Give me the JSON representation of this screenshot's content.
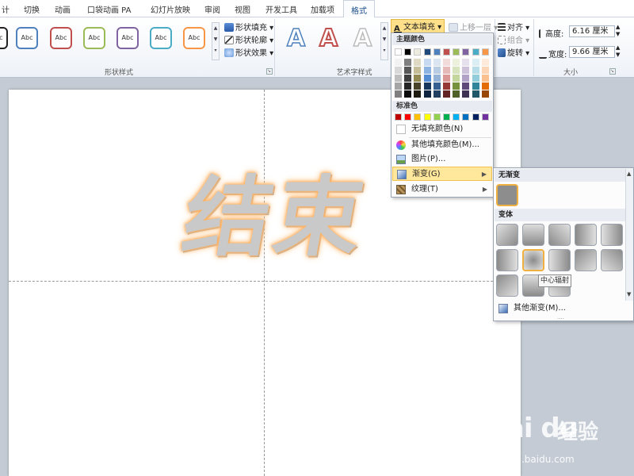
{
  "tabs": {
    "items": [
      "计",
      "切换",
      "动画",
      "口袋动画 PA",
      "幻灯片放映",
      "审阅",
      "视图",
      "开发工具",
      "加载项"
    ],
    "active": "格式"
  },
  "ribbon": {
    "shape_styles": {
      "gallery": [
        "Abc",
        "Abc",
        "Abc",
        "Abc",
        "Abc",
        "Abc",
        "Abc"
      ],
      "fill": "形状填充",
      "outline": "形状轮廓",
      "effects": "形状效果",
      "label": "形状样式"
    },
    "wordart_styles": {
      "letters": [
        "A",
        "A",
        "A"
      ],
      "text_fill": "文本填充",
      "label": "艺术字样式"
    },
    "arrange": {
      "bring_forward": "上移一层",
      "align": "对齐",
      "group": "组合",
      "rotate": "旋转"
    },
    "size": {
      "height_label": "高度:",
      "height_value": "6.16 厘米",
      "width_label": "宽度:",
      "width_value": "9.66 厘米",
      "label": "大小"
    }
  },
  "slide": {
    "wordart_text": "结束"
  },
  "fill_menu": {
    "theme_colors_header": "主题颜色",
    "standard_colors_header": "标准色",
    "theme_colors": {
      "top": [
        "#ffffff",
        "#000000",
        "#eeece1",
        "#1f497d",
        "#4f81bd",
        "#c0504d",
        "#9bbb59",
        "#8064a2",
        "#4bacc6",
        "#f79646"
      ],
      "tints": [
        [
          "#f2f2f2",
          "#7f7f7f",
          "#ddd9c3",
          "#c6d9f0",
          "#dbe5f1",
          "#f2dcdb",
          "#ebf1dd",
          "#e5e0ec",
          "#dbeef3",
          "#fdeada"
        ],
        [
          "#d8d8d8",
          "#595959",
          "#c4bd97",
          "#8db3e2",
          "#b8cce4",
          "#e5b9b7",
          "#d7e3bc",
          "#ccc1d9",
          "#b7dde8",
          "#fbd5b5"
        ],
        [
          "#bfbfbf",
          "#3f3f3f",
          "#938953",
          "#548dd4",
          "#95b3d7",
          "#d99694",
          "#c3d69b",
          "#b2a2c7",
          "#92cddc",
          "#fac08f"
        ],
        [
          "#a5a5a5",
          "#262626",
          "#494429",
          "#17365d",
          "#366092",
          "#953734",
          "#76923c",
          "#5f497a",
          "#31859b",
          "#e36c09"
        ],
        [
          "#7f7f7f",
          "#0c0c0c",
          "#1d1b10",
          "#0f243e",
          "#244061",
          "#632423",
          "#4f6128",
          "#3f3151",
          "#205867",
          "#974806"
        ]
      ]
    },
    "standard_colors": [
      "#c00000",
      "#ff0000",
      "#ffc000",
      "#ffff00",
      "#92d050",
      "#00b050",
      "#00b0f0",
      "#0070c0",
      "#002060",
      "#7030a0"
    ],
    "no_fill": "无填充颜色(N)",
    "more_colors": "其他填充颜色(M)...",
    "picture": "图片(P)...",
    "gradient": "渐变(G)",
    "texture": "纹理(T)"
  },
  "gradient_menu": {
    "no_gradient_header": "无渐变",
    "variants_header": "变体",
    "more_gradients": "其他渐变(M)...",
    "tooltip": "中心辐射"
  },
  "watermark": {
    "logo": "Bai du",
    "brand": "经验",
    "url": "jingyan.baidu.com"
  }
}
